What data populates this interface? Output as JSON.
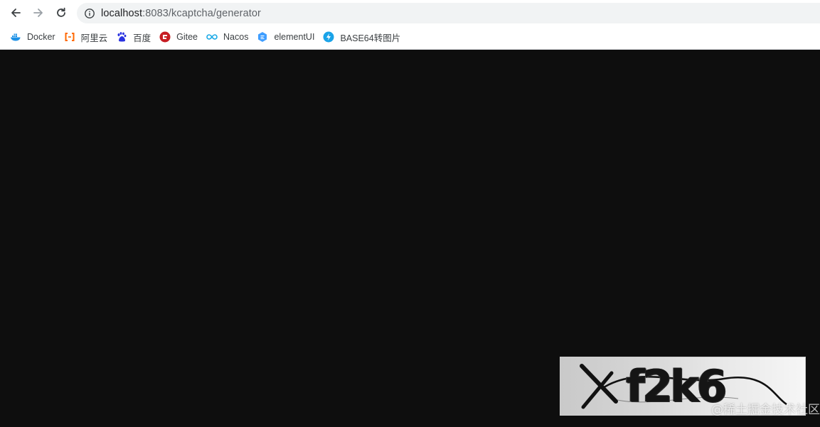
{
  "browser": {
    "url_host": "localhost",
    "url_rest": ":8083/kcaptcha/generator",
    "bookmarks": [
      {
        "label": "Docker",
        "icon": "docker-icon",
        "color": "#1d91e6"
      },
      {
        "label": "阿里云",
        "icon": "aliyun-icon",
        "color": "#ff6a00"
      },
      {
        "label": "百度",
        "icon": "baidu-icon",
        "color": "#2932e1"
      },
      {
        "label": "Gitee",
        "icon": "gitee-icon",
        "color": "#c71d23"
      },
      {
        "label": "Nacos",
        "icon": "nacos-icon",
        "color": "#1ba9e6"
      },
      {
        "label": "elementUI",
        "icon": "elementui-icon",
        "color": "#409eff"
      },
      {
        "label": "BASE64转图片",
        "icon": "lightning-icon",
        "color": "#1aa3e8"
      }
    ]
  },
  "page": {
    "background": "#0e0e0e",
    "captcha_text": "f2k6",
    "watermark": "@稀土掘金技术社区"
  }
}
